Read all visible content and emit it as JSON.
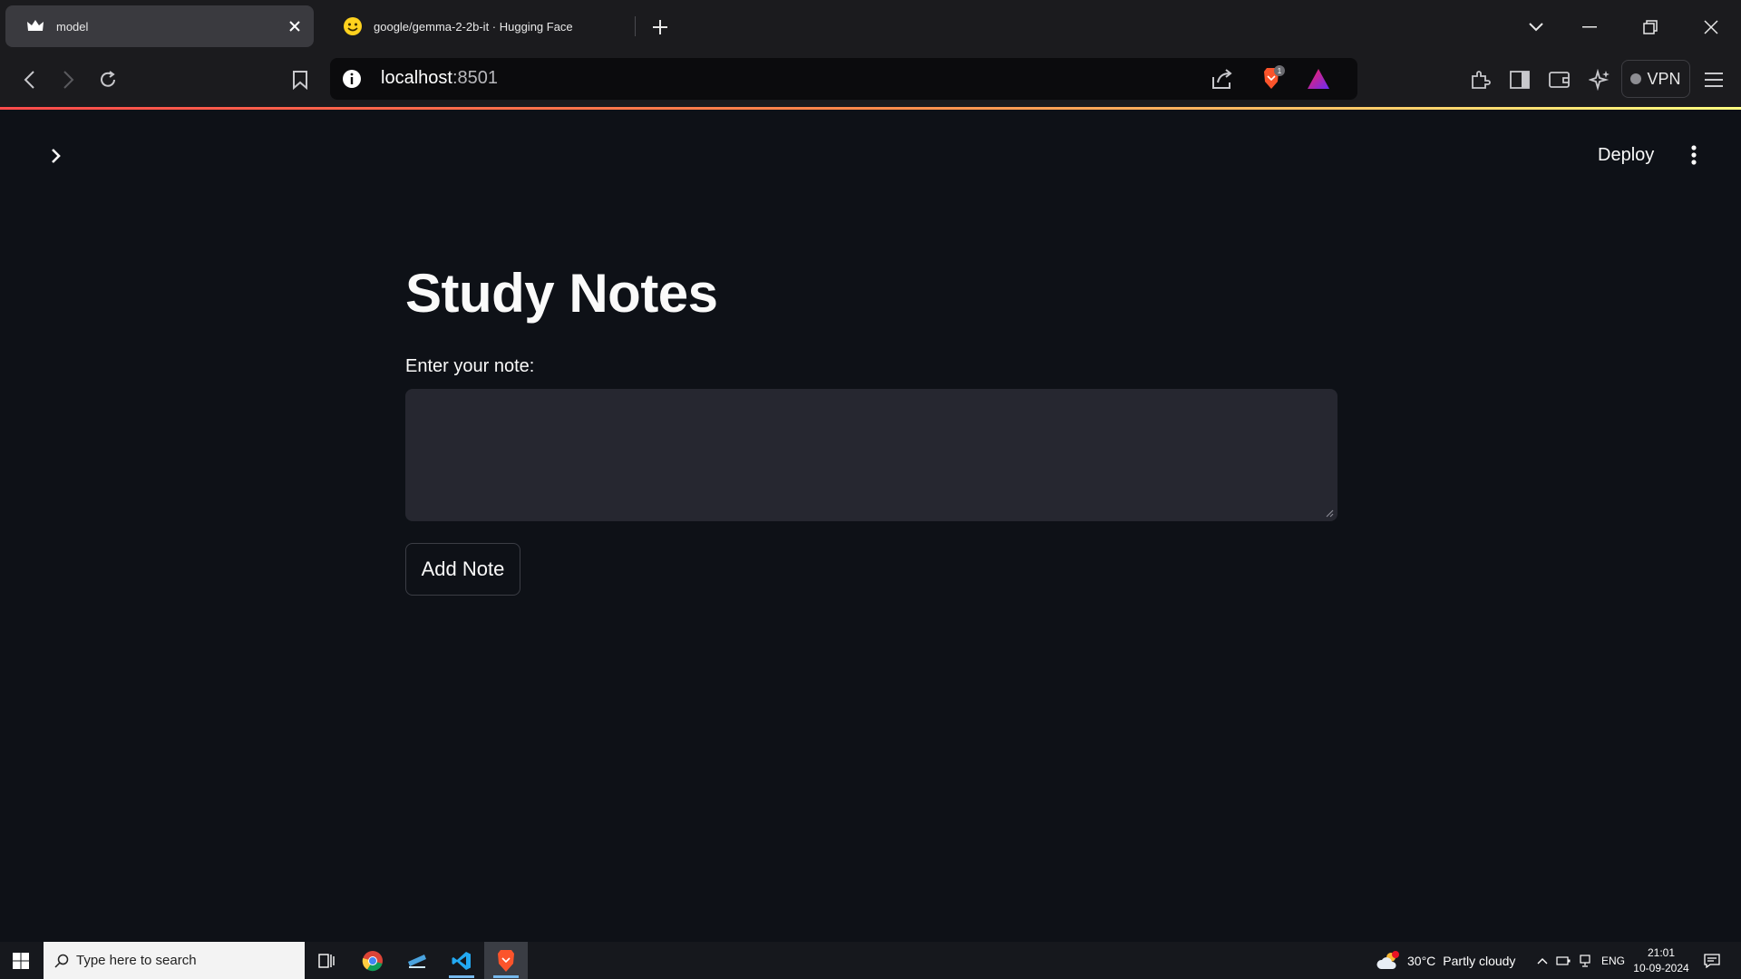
{
  "browser": {
    "tabs": [
      {
        "title": "model",
        "active": true,
        "icon": "streamlit-crown-icon"
      },
      {
        "title": "google/gemma-2-2b-it · Hugging Face",
        "active": false,
        "icon": "hugging-face-icon"
      }
    ],
    "url_host": "localhost",
    "url_port": ":8501",
    "vpn_label": "VPN",
    "brave_badge_count": "1"
  },
  "app": {
    "deploy_label": "Deploy",
    "title": "Study Notes",
    "note_label": "Enter your note:",
    "note_value": "",
    "add_button_label": "Add Note",
    "accent_color": "#ff4b4b"
  },
  "taskbar": {
    "search_placeholder": "Type here to search",
    "weather_temp": "30°C",
    "weather_desc": "Partly cloudy",
    "language": "ENG",
    "time": "21:01",
    "date": "10-09-2024"
  }
}
